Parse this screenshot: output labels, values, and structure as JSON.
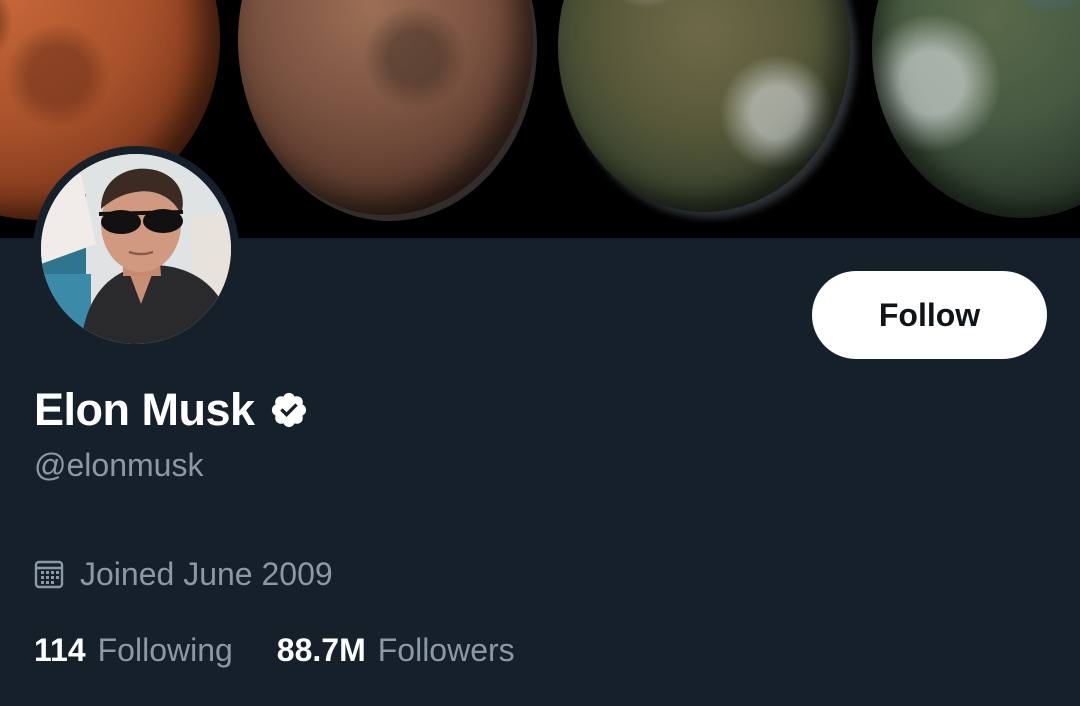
{
  "profile": {
    "display_name": "Elon Musk",
    "handle": "@elonmusk",
    "joined": "Joined June 2009",
    "verified": true
  },
  "actions": {
    "follow_label": "Follow"
  },
  "stats": {
    "following_count": "114",
    "following_label": "Following",
    "followers_count": "88.7M",
    "followers_label": "Followers"
  },
  "icons": {
    "verified": "verified-badge-icon",
    "joined": "calendar-icon"
  },
  "colors": {
    "background": "#15202b",
    "primary_text": "#ffffff",
    "secondary_text": "#8b98a5",
    "button_bg": "#ffffff",
    "button_text": "#0f1419"
  }
}
